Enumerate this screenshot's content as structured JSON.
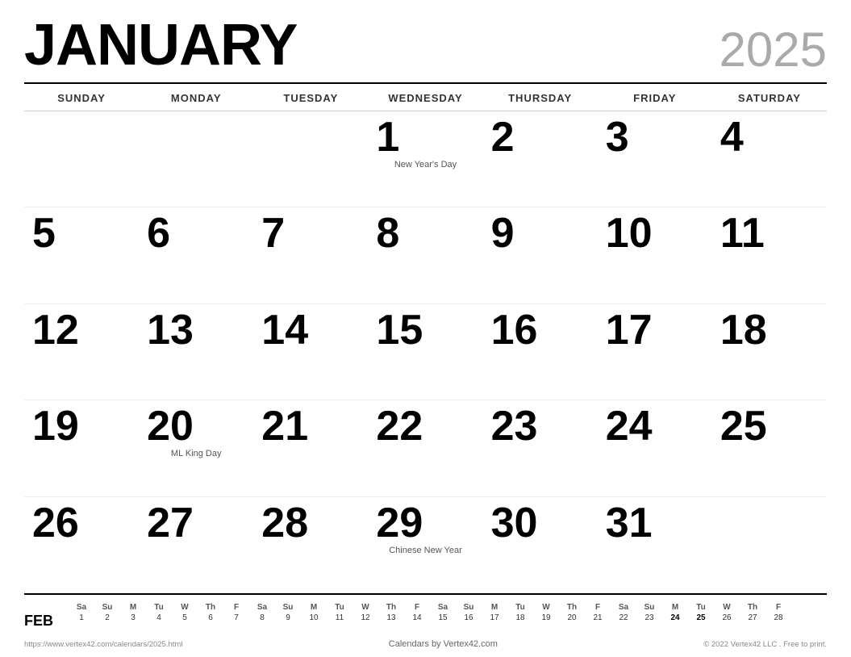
{
  "header": {
    "month": "JANUARY",
    "year": "2025"
  },
  "dayHeaders": [
    "SUNDAY",
    "MONDAY",
    "TUESDAY",
    "WEDNESDAY",
    "THURSDAY",
    "FRIDAY",
    "SATURDAY"
  ],
  "weeks": [
    [
      {
        "date": "",
        "event": ""
      },
      {
        "date": "",
        "event": ""
      },
      {
        "date": "",
        "event": ""
      },
      {
        "date": "1",
        "event": "New Year's Day"
      },
      {
        "date": "2",
        "event": ""
      },
      {
        "date": "3",
        "event": ""
      },
      {
        "date": "4",
        "event": ""
      }
    ],
    [
      {
        "date": "5",
        "event": ""
      },
      {
        "date": "6",
        "event": ""
      },
      {
        "date": "7",
        "event": ""
      },
      {
        "date": "8",
        "event": ""
      },
      {
        "date": "9",
        "event": ""
      },
      {
        "date": "10",
        "event": ""
      },
      {
        "date": "11",
        "event": ""
      }
    ],
    [
      {
        "date": "12",
        "event": ""
      },
      {
        "date": "13",
        "event": ""
      },
      {
        "date": "14",
        "event": ""
      },
      {
        "date": "15",
        "event": ""
      },
      {
        "date": "16",
        "event": ""
      },
      {
        "date": "17",
        "event": ""
      },
      {
        "date": "18",
        "event": ""
      }
    ],
    [
      {
        "date": "19",
        "event": ""
      },
      {
        "date": "20",
        "event": "ML King Day"
      },
      {
        "date": "21",
        "event": ""
      },
      {
        "date": "22",
        "event": ""
      },
      {
        "date": "23",
        "event": ""
      },
      {
        "date": "24",
        "event": ""
      },
      {
        "date": "25",
        "event": ""
      }
    ],
    [
      {
        "date": "26",
        "event": ""
      },
      {
        "date": "27",
        "event": ""
      },
      {
        "date": "28",
        "event": ""
      },
      {
        "date": "29",
        "event": "Chinese New Year"
      },
      {
        "date": "30",
        "event": ""
      },
      {
        "date": "31",
        "event": ""
      },
      {
        "date": "",
        "event": ""
      }
    ]
  ],
  "miniCalendar": {
    "label": "FEB",
    "dayHeaders": [
      "Sa",
      "Su",
      "M",
      "Tu",
      "W",
      "Th",
      "F",
      "Sa",
      "Su",
      "M",
      "Tu",
      "W",
      "Th",
      "F",
      "Sa",
      "Su",
      "M",
      "Tu",
      "W",
      "Th",
      "F",
      "Sa",
      "Su",
      "M",
      "Tu",
      "W",
      "Th",
      "F"
    ],
    "days": [
      "1",
      "2",
      "3",
      "4",
      "5",
      "6",
      "7",
      "8",
      "9",
      "10",
      "11",
      "12",
      "13",
      "14",
      "15",
      "16",
      "17",
      "18",
      "19",
      "20",
      "21",
      "22",
      "23",
      "24",
      "25",
      "26",
      "27",
      "28"
    ],
    "boldDays": [
      "24",
      "25"
    ]
  },
  "footer": {
    "left": "https://www.vertex42.com/calendars/2025.html",
    "center": "Calendars by Vertex42.com",
    "right": "© 2022 Vertex42 LLC . Free to print."
  }
}
